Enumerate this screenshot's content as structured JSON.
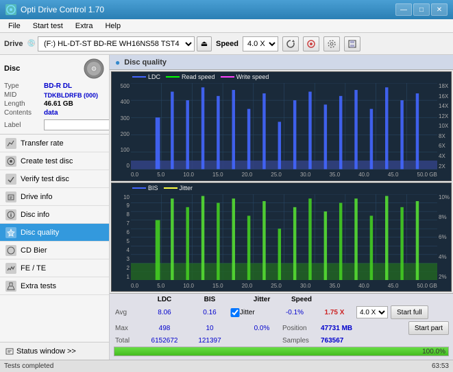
{
  "titlebar": {
    "title": "Opti Drive Control 1.70",
    "icon": "ODC",
    "minimize": "—",
    "maximize": "□",
    "close": "✕"
  },
  "menubar": {
    "items": [
      "File",
      "Start test",
      "Extra",
      "Help"
    ]
  },
  "toolbar": {
    "drive_label": "Drive",
    "drive_value": "(F:)  HL-DT-ST BD-RE  WH16NS58 TST4",
    "eject_icon": "⏏",
    "speed_label": "Speed",
    "speed_value": "4.0 X",
    "icons": [
      "refresh",
      "burn",
      "settings",
      "save"
    ]
  },
  "left_panel": {
    "disc_title": "Disc",
    "disc_info": {
      "type_label": "Type",
      "type_value": "BD-R DL",
      "mid_label": "MID",
      "mid_value": "TDKBLDRFB (000)",
      "length_label": "Length",
      "length_value": "46.61 GB",
      "contents_label": "Contents",
      "contents_value": "data",
      "label_label": "Label",
      "label_value": ""
    },
    "nav_items": [
      {
        "id": "transfer-rate",
        "label": "Transfer rate",
        "icon": "📈"
      },
      {
        "id": "create-test-disc",
        "label": "Create test disc",
        "icon": "💿"
      },
      {
        "id": "verify-test-disc",
        "label": "Verify test disc",
        "icon": "✔"
      },
      {
        "id": "drive-info",
        "label": "Drive info",
        "icon": "ℹ"
      },
      {
        "id": "disc-info",
        "label": "Disc info",
        "icon": "📀"
      },
      {
        "id": "disc-quality",
        "label": "Disc quality",
        "icon": "⭐",
        "active": true
      },
      {
        "id": "cd-bier",
        "label": "CD Bier",
        "icon": "🍺"
      },
      {
        "id": "fe-te",
        "label": "FE / TE",
        "icon": "📊"
      },
      {
        "id": "extra-tests",
        "label": "Extra tests",
        "icon": "🔬"
      }
    ],
    "status_window": "Status window >>"
  },
  "quality": {
    "title": "Disc quality",
    "chart1": {
      "title": "LDC / Read speed / Write speed",
      "legend": [
        {
          "label": "LDC",
          "color": "#3366ff"
        },
        {
          "label": "Read speed",
          "color": "#00ff00"
        },
        {
          "label": "Write speed",
          "color": "#ff44ff"
        }
      ],
      "y_labels": [
        "500",
        "400",
        "300",
        "200",
        "100",
        "0"
      ],
      "y_labels_right": [
        "18X",
        "16X",
        "14X",
        "12X",
        "10X",
        "8X",
        "6X",
        "4X",
        "2X"
      ],
      "x_labels": [
        "0.0",
        "5.0",
        "10.0",
        "15.0",
        "20.0",
        "25.0",
        "30.0",
        "35.0",
        "40.0",
        "45.0",
        "50.0 GB"
      ]
    },
    "chart2": {
      "title": "BIS / Jitter",
      "legend": [
        {
          "label": "BIS",
          "color": "#3366ff"
        },
        {
          "label": "Jitter",
          "color": "#ffff00"
        }
      ],
      "y_labels": [
        "10",
        "9",
        "8",
        "7",
        "6",
        "5",
        "4",
        "3",
        "2",
        "1"
      ],
      "y_labels_right": [
        "10%",
        "8%",
        "6%",
        "4%",
        "2%"
      ],
      "x_labels": [
        "0.0",
        "5.0",
        "10.0",
        "15.0",
        "20.0",
        "25.0",
        "30.0",
        "35.0",
        "40.0",
        "45.0",
        "50.0 GB"
      ]
    },
    "stats": {
      "headers": [
        "",
        "LDC",
        "BIS",
        "",
        "Jitter",
        "Speed",
        ""
      ],
      "avg_label": "Avg",
      "avg_ldc": "8.06",
      "avg_bis": "0.16",
      "avg_jitter": "-0.1%",
      "avg_speed": "1.75 X",
      "speed_dropdown": "4.0 X",
      "max_label": "Max",
      "max_ldc": "498",
      "max_bis": "10",
      "max_jitter": "0.0%",
      "position_label": "Position",
      "position_value": "47731 MB",
      "total_label": "Total",
      "total_ldc": "6152672",
      "total_bis": "121397",
      "samples_label": "Samples",
      "samples_value": "763567",
      "jitter_checked": true,
      "jitter_label": "Jitter",
      "btn_start_full": "Start full",
      "btn_start_part": "Start part"
    },
    "progress": {
      "value": 100,
      "percent_text": "100.0%",
      "time_text": "63:53"
    }
  },
  "statusbar": {
    "text": "Tests completed"
  }
}
